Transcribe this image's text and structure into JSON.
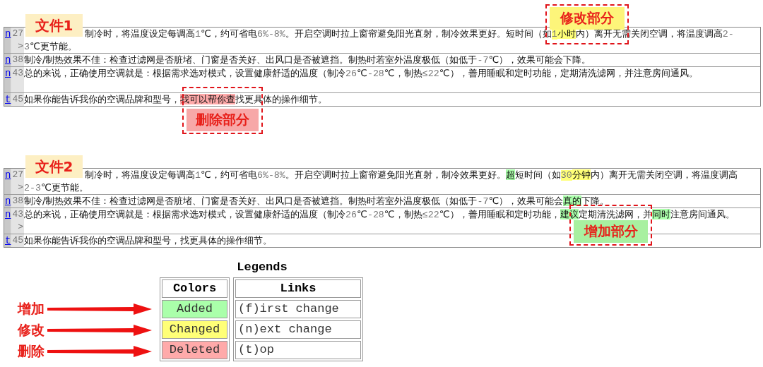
{
  "diffs": [
    {
      "label": "文件1",
      "rows": [
        {
          "link": "n",
          "number": "27",
          "lines": [
            {
              "segs": [
                {
                  "t": "制冷时，将温度设定每调高"
                },
                {
                  "t": "1",
                  "mono": true
                },
                {
                  "t": "℃，约可省电"
                },
                {
                  "t": "6%-8%",
                  "mono": true
                },
                {
                  "t": "。开启空调时拉上窗帘避免阳光直射，制冷效果更好。短时间（如"
                },
                {
                  "t": "1",
                  "mono": true,
                  "kind": "changed"
                },
                {
                  "t": "小时",
                  "kind": "changed"
                },
                {
                  "t": "内）离开无需关闭空调，将温度调高"
                },
                {
                  "t": "2-",
                  "mono": true
                }
              ]
            },
            {
              "marker": ">",
              "segs": [
                {
                  "t": "3",
                  "mono": true
                },
                {
                  "t": "℃更节能。"
                }
              ]
            }
          ]
        },
        {
          "link": "n",
          "number": "38",
          "lines": [
            {
              "segs": [
                {
                  "t": "制冷/制热效果不佳：检查过滤网是否脏堵、门窗是否关好、出风口是否被遮挡。制热时若室外温度极低（如低于"
                },
                {
                  "t": "-7",
                  "mono": true
                },
                {
                  "t": "℃），效果可能会下降。"
                }
              ]
            }
          ]
        },
        {
          "link": "n",
          "number": "43",
          "lines": [
            {
              "segs": [
                {
                  "t": "总的来说，正确使用空调就是：根据需求选对模式，设置健康舒适的温度（制冷"
                },
                {
                  "t": "26",
                  "mono": true
                },
                {
                  "t": "℃"
                },
                {
                  "t": "-28",
                  "mono": true
                },
                {
                  "t": "℃，制热"
                },
                {
                  "t": "≤22",
                  "mono": true
                },
                {
                  "t": "℃），善用睡眠和定时功能，定期清洗滤网，并注意房间通风。"
                }
              ]
            }
          ],
          "trailing_blank": true
        },
        {
          "link": "t",
          "number": "45",
          "lines": [
            {
              "segs": [
                {
                  "t": "如果你能告诉我你的空调品牌和型号，"
                },
                {
                  "t": "我可以帮你查",
                  "kind": "deleted"
                },
                {
                  "t": "找更具体的操作细节。"
                }
              ]
            }
          ]
        }
      ],
      "callouts": [
        {
          "text": "修改部分",
          "kind": "changed"
        },
        {
          "text": "删除部分",
          "kind": "deleted"
        }
      ]
    },
    {
      "label": "文件2",
      "rows": [
        {
          "link": "n",
          "number": "27",
          "lines": [
            {
              "segs": [
                {
                  "t": "制冷时，将温度设定每调高"
                },
                {
                  "t": "1",
                  "mono": true
                },
                {
                  "t": "℃，约可省电"
                },
                {
                  "t": "6%-8%",
                  "mono": true
                },
                {
                  "t": "。开启空调时拉上窗帘避免阳光直射，制冷效果更好。"
                },
                {
                  "t": "超",
                  "kind": "added"
                },
                {
                  "t": "短时间（如"
                },
                {
                  "t": "30",
                  "mono": true,
                  "kind": "changed"
                },
                {
                  "t": "分钟",
                  "kind": "changed"
                },
                {
                  "t": "内）离开无需关闭空调，将温度调高"
                }
              ]
            },
            {
              "marker": ">",
              "segs": [
                {
                  "t": "2-3",
                  "mono": true
                },
                {
                  "t": "℃更节能。"
                }
              ]
            }
          ]
        },
        {
          "link": "n",
          "number": "38",
          "lines": [
            {
              "segs": [
                {
                  "t": "制冷/制热效果不佳：检查过滤网是否脏堵、门窗是否关好、出风口是否被遮挡。制热时若室外温度极低（如低于"
                },
                {
                  "t": "-7",
                  "mono": true
                },
                {
                  "t": "℃），效果可能会"
                },
                {
                  "t": "真的",
                  "kind": "added"
                },
                {
                  "t": "下降。"
                }
              ]
            }
          ]
        },
        {
          "link": "n",
          "number": "43",
          "lines": [
            {
              "segs": [
                {
                  "t": "总的来说，正确使用空调就是：根据需求选对模式，设置健康舒适的温度（制冷"
                },
                {
                  "t": "26",
                  "mono": true
                },
                {
                  "t": "℃"
                },
                {
                  "t": "-28",
                  "mono": true
                },
                {
                  "t": "℃，制热"
                },
                {
                  "t": "≤22",
                  "mono": true
                },
                {
                  "t": "℃），善用睡眠和定时功能，"
                },
                {
                  "t": "建议",
                  "kind": "added"
                },
                {
                  "t": "定期清洗滤网，并"
                },
                {
                  "t": "同时",
                  "kind": "added"
                },
                {
                  "t": "注意房间通风。"
                }
              ]
            },
            {
              "marker": ">"
            }
          ]
        },
        {
          "link": "t",
          "number": "45",
          "lines": [
            {
              "segs": [
                {
                  "t": "如果你能告诉我你的空调品牌和型号，找更具体的操作细节。"
                }
              ]
            }
          ]
        }
      ],
      "callouts": [
        {
          "text": "增加部分",
          "kind": "added"
        }
      ]
    }
  ],
  "legend": {
    "title": "Legends",
    "colors": {
      "heading": "Colors",
      "items": [
        {
          "text": "Added",
          "kind": "added",
          "note": "增加"
        },
        {
          "text": "Changed",
          "kind": "changed",
          "note": "修改"
        },
        {
          "text": "Deleted",
          "kind": "deleted",
          "note": "删除"
        }
      ]
    },
    "links": {
      "heading": "Links",
      "items": [
        "(f)irst change",
        "(n)ext change",
        "(t)op"
      ]
    }
  }
}
